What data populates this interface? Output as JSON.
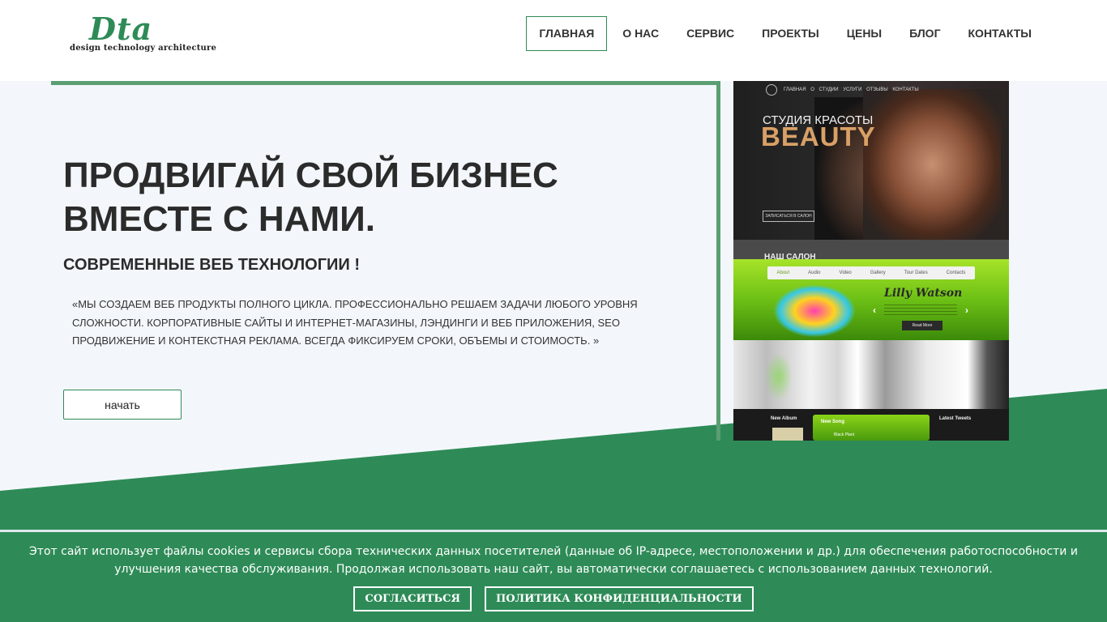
{
  "header": {
    "logo": {
      "mark": "Dta",
      "tagline": "design technology architecture"
    },
    "nav": [
      {
        "label": "ГЛАВНАЯ",
        "active": true
      },
      {
        "label": "О НАС"
      },
      {
        "label": "СЕРВИС"
      },
      {
        "label": "ПРОЕКТЫ"
      },
      {
        "label": "ЦЕНЫ"
      },
      {
        "label": "БЛОГ"
      },
      {
        "label": "КОНТАКТЫ"
      }
    ]
  },
  "hero": {
    "title": "ПРОДВИГАЙ СВОЙ БИЗНЕС ВМЕСТЕ С НАМИ.",
    "subtitle": "СОВРЕМЕННЫЕ ВЕБ ТЕХНОЛОГИИ !",
    "text": "«МЫ СОЗДАЕМ ВЕБ ПРОДУКТЫ ПОЛНОГО ЦИКЛА. ПРОФЕССИОНАЛЬНО РЕШАЕМ ЗАДАЧИ ЛЮБОГО УРОВНЯ СЛОЖНОСТИ. КОРПОРАТИВНЫЕ САЙТЫ И ИНТЕРНЕТ-МАГАЗИНЫ, ЛЭНДИНГИ И ВЕБ ПРИЛОЖЕНИЯ, SEO ПРОДВИЖЕНИЕ И КОНТЕКСТНАЯ РЕКЛАМА. ВСЕГДА ФИКСИРУЕМ СРОКИ, ОБЪЕМЫ И СТОИМОСТЬ. »",
    "button": "начать"
  },
  "mockup": {
    "nav": "ГЛАВНАЯ  О СТУДИИ  УСЛУГИ  ОТЗЫВЫ  КОНТАКТЫ",
    "studio": "СТУДИЯ КРАСОТЫ",
    "beauty": "BEAUTY",
    "book": "ЗАПИСАТЬСЯ В САЛОН",
    "salon": "НАШ САЛОН",
    "menu": [
      "About",
      "Audio",
      "Video",
      "Gallery",
      "Tour Dates",
      "Contacts"
    ],
    "artist": "Lilly Watson",
    "read_more": "Read More",
    "new_album": "New Album",
    "new_song": "New Song",
    "song_title": "Black Plant",
    "latest_tweets": "Latest Tweets"
  },
  "cookie": {
    "text": "Этот сайт использует файлы cookies и сервисы сбора технических данных посетителей (данные об IP-адресе, местоположении и др.) для обеспечения работоспособности и улучшения качества обслуживания. Продолжая использовать наш сайт, вы автоматически соглашаетесь с использованием данных технологий.",
    "agree": "СОГЛАСИТЬСЯ",
    "privacy": "ПОЛИТИКА КОНФИДЕНЦИАЛЬНОСТИ"
  },
  "colors": {
    "brand_green": "#2e8b57",
    "panel_border": "#5a9e72",
    "hero_background": "#f3f7fb"
  }
}
